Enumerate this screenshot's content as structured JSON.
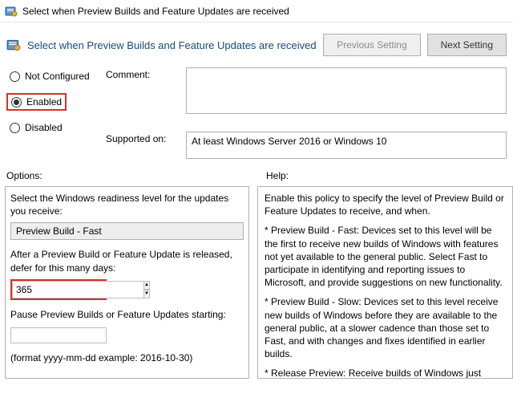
{
  "window": {
    "title": "Select when Preview Builds and Feature Updates are received"
  },
  "subheader": {
    "text": "Select when Preview Builds and Feature Updates are received"
  },
  "nav": {
    "previous": "Previous Setting",
    "next": "Next Setting"
  },
  "radios": {
    "not_configured": "Not Configured",
    "enabled": "Enabled",
    "disabled": "Disabled"
  },
  "form": {
    "comment_label": "Comment:",
    "supported_label": "Supported on:",
    "supported_value": "At least Windows Server 2016 or Windows 10"
  },
  "sections": {
    "options": "Options:",
    "help": "Help:"
  },
  "options": {
    "readiness_label": "Select the Windows readiness level for the updates you receive:",
    "readiness_value": "Preview Build - Fast",
    "defer_label": "After a Preview Build or Feature Update is released, defer for this many days:",
    "defer_value": "365",
    "pause_label": "Pause Preview Builds or Feature Updates starting:",
    "pause_value": "",
    "format_hint": "(format yyyy-mm-dd example: 2016-10-30)"
  },
  "help": {
    "p1": "Enable this policy to specify the level of Preview Build or Feature Updates to receive, and when.",
    "p2": "* Preview Build - Fast: Devices set to this level will be the first to receive new builds of Windows with features not yet available to the general public. Select Fast to participate in identifying and reporting issues to Microsoft, and provide suggestions on new functionality.",
    "p3": "* Preview Build - Slow: Devices set to this level receive new builds of Windows before they are available to the general public, at a slower cadence than those set to Fast, and with changes and fixes identified in earlier builds.",
    "p4": "* Release Preview: Receive builds of Windows just before Microsoft releases them to the general public."
  }
}
